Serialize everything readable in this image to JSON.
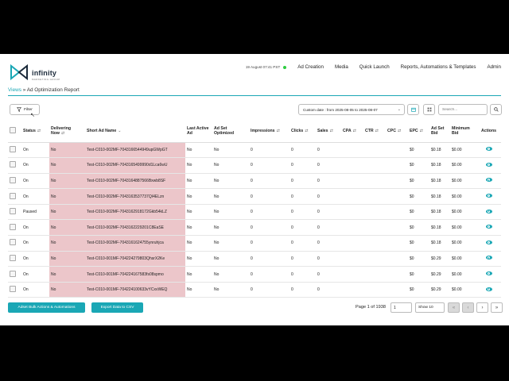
{
  "brand": {
    "name": "infinity",
    "tagline": "MARKETING GROUP",
    "accent": "#1aa7b5"
  },
  "nav": {
    "timestamp": "19 August 07:41 PST",
    "items": [
      "Ad Creation",
      "Media",
      "Quick Launch",
      "Reports, Automations & Templates",
      "Admin"
    ]
  },
  "breadcrumb": {
    "root": "Views",
    "separator": "»",
    "current": "Ad Optimization Report"
  },
  "toolbar": {
    "filter_label": "Filter",
    "date_range": "Custom date : from 2025-08-05 to 2025-08-07",
    "search_placeholder": "Search..."
  },
  "table": {
    "headers": [
      "Status",
      "Delivering Now",
      "Short Ad Name",
      "Last Active Ad",
      "Ad Set Optimized",
      "Impressions",
      "Clicks",
      "Sales",
      "CPA",
      "CTR",
      "CPC",
      "EPC",
      "Ad Set Bid",
      "Minimum Bid",
      "Actions"
    ],
    "rows": [
      [
        "On",
        "No",
        "Test-C010-002MF-7043166544949upGWpGT",
        "No",
        "No",
        "0",
        "0",
        "0",
        "",
        "",
        "",
        "$0",
        "$0.18",
        "$0.00"
      ],
      [
        "On",
        "No",
        "Test-C010-002MF-7043165499990d1Lca6wU",
        "No",
        "No",
        "0",
        "0",
        "0",
        "",
        "",
        "",
        "$0",
        "$0.18",
        "$0.00"
      ],
      [
        "On",
        "No",
        "Test-C010-002MF-7043164887566Bxwb8SF",
        "No",
        "No",
        "0",
        "0",
        "0",
        "",
        "",
        "",
        "$0",
        "$0.18",
        "$0.00"
      ],
      [
        "On",
        "No",
        "Test-C010-002MF-7043163537737QI4ELzn",
        "No",
        "No",
        "0",
        "0",
        "0",
        "",
        "",
        "",
        "$0",
        "$0.18",
        "$0.00"
      ],
      [
        "Paused",
        "No",
        "Test-C010-002MF-7043162918172Gkb54kLZ",
        "No",
        "No",
        "0",
        "0",
        "0",
        "",
        "",
        "",
        "$0",
        "$0.18",
        "$0.00"
      ],
      [
        "On",
        "No",
        "Test-C010-002MF-7043162229201C8EaSE",
        "No",
        "No",
        "0",
        "0",
        "0",
        "",
        "",
        "",
        "$0",
        "$0.18",
        "$0.00"
      ],
      [
        "On",
        "No",
        "Test-C010-002MF-7043161624755ynruhjca",
        "No",
        "No",
        "0",
        "0",
        "0",
        "",
        "",
        "",
        "$0",
        "$0.18",
        "$0.00"
      ],
      [
        "On",
        "No",
        "Test-C010-001MF-704224279803QhsrX2Ke",
        "No",
        "No",
        "0",
        "0",
        "0",
        "",
        "",
        "",
        "$0",
        "$0.29",
        "$0.00"
      ],
      [
        "On",
        "No",
        "Test-C010-001MF-704224167583fs08spmo",
        "No",
        "No",
        "0",
        "0",
        "0",
        "",
        "",
        "",
        "$0",
        "$0.29",
        "$0.00"
      ],
      [
        "On",
        "No",
        "Test-C010-001MF-704224100633vYCxvWEQ",
        "No",
        "No",
        "0",
        "0",
        "0",
        "",
        "",
        "",
        "$0",
        "$0.29",
        "$0.00"
      ]
    ]
  },
  "footer": {
    "bulk_actions_label": "Adset Bulk Actions & Automations",
    "export_label": "Export Data to CSV",
    "page_prefix": "Page 1 of 1938",
    "page_value": "1",
    "show_label": "Show 10"
  }
}
